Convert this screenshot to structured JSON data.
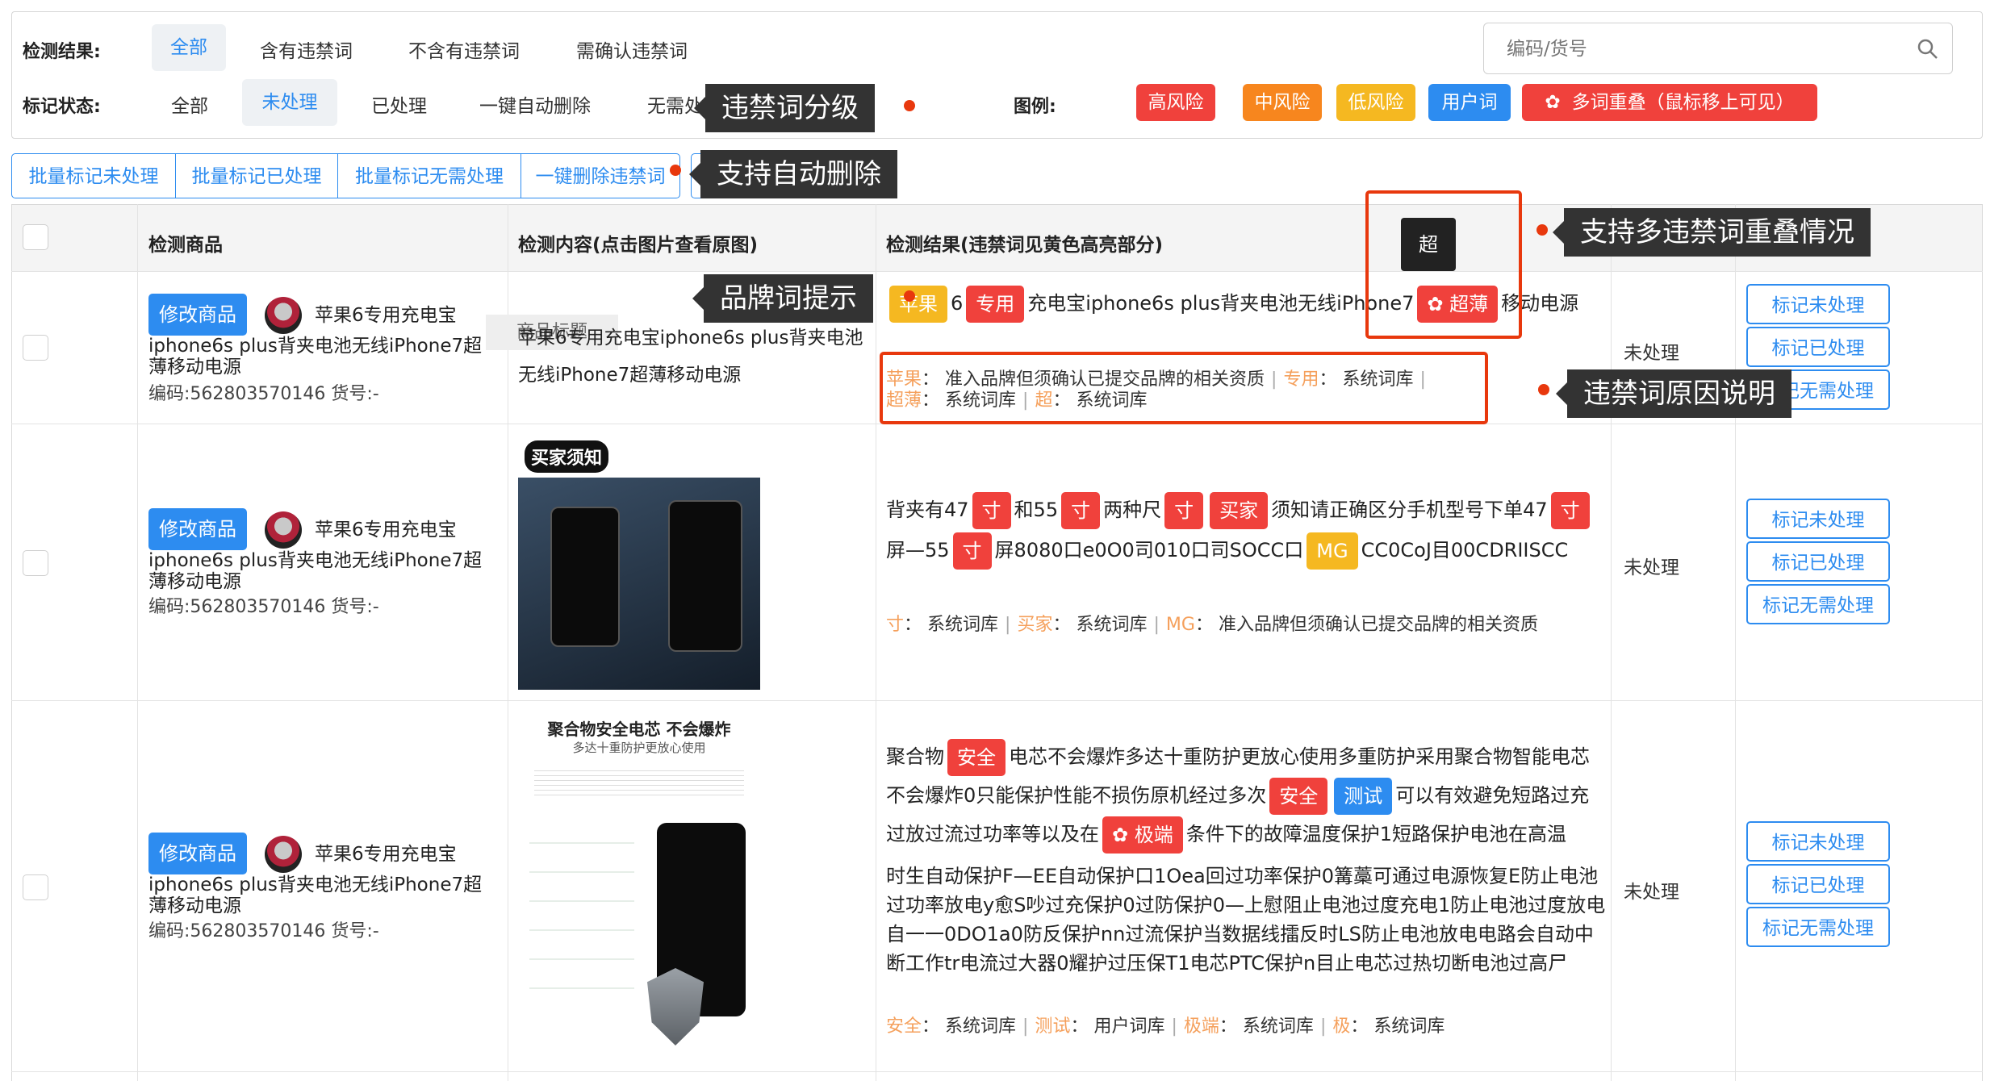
{
  "filters": {
    "result_label": "检测结果:",
    "result_options": [
      "全部",
      "含有违禁词",
      "不含有违禁词",
      "需确认违禁词"
    ],
    "status_label": "标记状态:",
    "status_options": [
      "全部",
      "未处理",
      "已处理",
      "一键自动删除",
      "无需处理"
    ],
    "search_placeholder": "编码/货号",
    "legend_label": "图例:",
    "legend": [
      "高风险",
      "中风险",
      "低风险",
      "用户词",
      "多词重叠（鼠标移上可见）"
    ]
  },
  "bulk": [
    "批量标记未处理",
    "批量标记已处理",
    "批量标记无需处理",
    "一键删除违禁词"
  ],
  "callouts": {
    "grading": "违禁词分级",
    "autodelete": "支持自动删除",
    "overlap": "支持多违禁词重叠情况",
    "brand": "品牌词提示",
    "reason": "违禁词原因说明"
  },
  "table": {
    "headers": [
      "检测商品",
      "检测内容(点击图片查看原图)",
      "检测结果(违禁词见黄色高亮部分)"
    ],
    "edit_label": "修改商品",
    "tooltip_label": "商品标题",
    "overlap_tooltip": "超",
    "rows": [
      {
        "product_title_line1": "苹果6专用充电宝",
        "product_title_rest": "iphone6s plus背夹电池无线iPhone7超薄移动电源",
        "code": "编码:562803570146  货号:-",
        "content_text": "苹果6专用充电宝iphone6s plus背夹电池无线iPhone7超薄移动电源",
        "status": "未处理",
        "result_line1": [
          "苹果",
          "6",
          "专用",
          "充电宝iphone6s plus背夹电池无线iPhone7",
          "超薄",
          "移动电源"
        ],
        "reasons_line1": [
          [
            "苹果",
            "准入品牌但须确认已提交品牌的相关资质"
          ],
          [
            "专用",
            "系统词库"
          ]
        ],
        "reasons_line2": [
          [
            "超薄",
            "系统词库"
          ],
          [
            "超",
            "系统词库"
          ]
        ],
        "actions": [
          "标记未处理",
          "标记已处理",
          "标记无需处理"
        ]
      },
      {
        "product_title_line1": "苹果6专用充电宝",
        "product_title_rest": "iphone6s plus背夹电池无线iPhone7超薄移动电源",
        "code": "编码:562803570146  货号:-",
        "image_caption": "买家须知",
        "status": "未处理",
        "result_line1": [
          "背夹有47",
          "寸",
          "和55",
          "寸",
          "两种尺",
          "寸",
          "买家",
          "须知请正确区分手机型号下单47",
          "寸"
        ],
        "result_line2": [
          "屏—55",
          "寸",
          "屏8080口e0O0司010口司SOCC口",
          "MG",
          "CC0CoJ目00CDRIISCC"
        ],
        "reasons": [
          [
            "寸",
            "系统词库"
          ],
          [
            "买家",
            "系统词库"
          ],
          [
            "MG",
            "准入品牌但须确认已提交品牌的相关资质"
          ]
        ],
        "actions": [
          "标记未处理",
          "标记已处理",
          "标记无需处理"
        ]
      },
      {
        "product_title_line1": "苹果6专用充电宝",
        "product_title_rest": "iphone6s plus背夹电池无线iPhone7超薄移动电源",
        "code": "编码:562803570146  货号:-",
        "image_caption": "聚合物安全电芯 不会爆炸",
        "image_sub": "多达十重防护更放心使用",
        "status": "未处理",
        "result_line1": [
          "聚合物",
          "安全",
          "电芯不会爆炸多达十重防护更放心使用多重防护采用聚合物智能电芯"
        ],
        "result_line2": [
          "不会爆炸0只能保护性能不损伤原机经过多次",
          "安全",
          "测试",
          "可以有效避免短路过充"
        ],
        "result_line3": [
          "过放过流过功率等以及在",
          "极端",
          "条件下的故障温度保护1短路保护电池在高温"
        ],
        "result_line4": "时生自动保护F—EE自动保护口1Oea回过功率保护0篝藁可通过电源恢复E防止电池",
        "result_line5": "过功率放电y愈S吵过充保护0过防保护0—上慰阻止电池过度充电1防止电池过度放电",
        "result_line6": "自一一0DO1a0防反保护nn过流保护当数据线擂反时LS防止电池放电电路会自动中",
        "result_line7": "断工作tr电流过大器0耀护过压保T1电芯PTC保护n目止电芯过热切断电池过高尸",
        "reasons": [
          [
            "安全",
            "系统词库"
          ],
          [
            "测试",
            "用户词库"
          ],
          [
            "极端",
            "系统词库"
          ],
          [
            "极",
            "系统词库"
          ]
        ],
        "actions": [
          "标记未处理",
          "标记已处理",
          "标记无需处理"
        ]
      }
    ]
  },
  "colors": {
    "accent": "#2d8cf0",
    "high": "#f0413c",
    "mid": "#f7861e",
    "low": "#f5b821",
    "user": "#2d8cf0",
    "callout": "#e8380d"
  }
}
